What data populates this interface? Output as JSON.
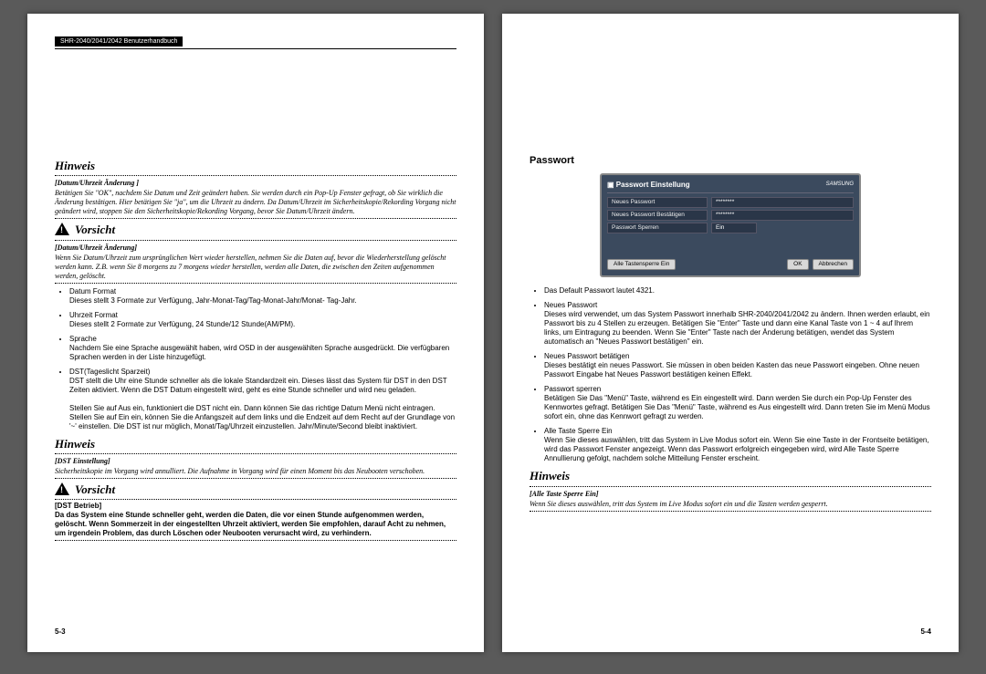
{
  "header": "SHR-2040/2041/2042 Benutzerhandbuch",
  "left": {
    "hinweis1_title": "Hinweis",
    "hinweis1_sub": "[Datum/Uhrzeit Änderung ]",
    "hinweis1_body": "Betätigen Sie \"OK\", nachdem Sie Datum und Zeit geändert haben. Sie werden durch ein Pop-Up Fenster gefragt, ob Sie wirklich die Änderung bestätigen. Hier betätigen Sie \"ja\", um die Uhrzeit zu ändern. Da Datum/Uhrzeit im Sicherheitskopie/Rekording Vorgang nicht geändert wird, stoppen Sie den Sicherheitskopie/Rekording Vorgang, bevor Sie Datum/Uhrzeit ändern.",
    "vorsicht1_title": "Vorsicht",
    "vorsicht1_sub": "[Datum/Uhrzeit Änderung]",
    "vorsicht1_body": "Wenn Sie Datum/Uhrzeit zum ursprünglichen Wert wieder herstellen, nehmen Sie die Daten auf, bevor die Wiederherstellung gelöscht werden kann. Z.B. wenn Sie 8 morgens zu 7 morgens wieder herstellen, werden alle Daten, die zwischen den Zeiten aufgenommen werden, gelöscht.",
    "b1_label": "Datum Format",
    "b1_text": "Dieses stellt 3 Formate zur Verfügung, Jahr-Monat-Tag/Tag-Monat-Jahr/Monat- Tag-Jahr.",
    "b2_label": "Uhrzeit Format",
    "b2_text": "Dieses stellt 2 Formate zur Verfügung, 24 Stunde/12 Stunde(AM/PM).",
    "b3_label": "Sprache",
    "b3_text": "Nachdem Sie eine Sprache ausgewählt haben, wird OSD in der ausgewählten Sprache ausgedrückt. Die verfügbaren Sprachen werden in der Liste hinzugefügt.",
    "b4_label": "DST(Tageslicht Sparzeit)",
    "b4_text": "DST stellt die Uhr eine Stunde schneller als die lokale Standardzeit ein. Dieses lässt das System für DST in den DST Zeiten aktiviert. Wenn die DST Datum eingestellt wird, geht es eine Stunde schneller und wird neu geladen.",
    "b4_text2": "Stellen Sie auf Aus ein, funktioniert die DST nicht ein. Dann können Sie das richtige Datum Menü nicht eintragen. Stellen Sie auf Ein ein, können Sie die Anfangszeit auf dem links und die Endzeit auf dem Recht auf der Grundlage von '~' einstellen. Die DST ist nur möglich, Monat/Tag/Uhrzeit einzustellen. Jahr/Minute/Second bleibt inaktiviert.",
    "hinweis2_title": "Hinweis",
    "hinweis2_sub": "[DST Einstellung]",
    "hinweis2_body": "Sicherheitskopie im Vorgang wird annulliert. Die Aufnahme in Vorgang wird für einen Moment bis das Neubooten verschoben.",
    "vorsicht2_title": "Vorsicht",
    "vorsicht2_sub": "[DST Betrieb]",
    "vorsicht2_body": "Da das System eine Stunde schneller geht, werden die Daten, die vor einen Stunde aufgenommen werden, gelöscht. Wenn Sommerzeit in der eingestellten Uhrzeit aktiviert, werden Sie empfohlen, darauf Acht zu nehmen, um irgendein Problem, das durch Löschen oder Neubooten verursacht wird, zu verhindern.",
    "pagenum": "5-3"
  },
  "right": {
    "section_title": "Passwort",
    "ui": {
      "title": "Passwort Einstellung",
      "logo": "SAMSUNG",
      "row1_label": "Neues Passwort",
      "row1_value": "********",
      "row2_label": "Neues Passwort Bestätigen",
      "row2_value": "********",
      "row3_label": "Passwort Sperren",
      "row3_value": "Ein",
      "btn_left": "Alle Tastensperre Ein",
      "btn_ok": "OK",
      "btn_cancel": "Abbrechen"
    },
    "b1": "Das Default Passwort lautet 4321.",
    "b2_label": "Neues Passwort",
    "b2_text": "Dieses wird verwendet, um das System Passwort innerhalb SHR-2040/2041/2042 zu ändern. Ihnen werden erlaubt, ein Passwort bis zu 4 Stellen zu erzeugen. Betätigen Sie \"Enter\" Taste und dann eine Kanal Taste von 1 ~ 4 auf Ihrem links, um Eintragung zu beenden. Wenn Sie \"Enter\" Taste nach der Änderung betätigen, wendet das System automatisch an \"Neues Passwort bestätigen\" ein.",
    "b3_label": "Neues Passwort betätigen",
    "b3_text": "Dieses bestätigt ein neues Passwort. Sie müssen in oben beiden Kasten das neue Passwort eingeben. Ohne neuen Passwort Eingabe hat Neues Passwort bestätigen keinen Effekt.",
    "b4_label": "Passwort sperren",
    "b4_text": "Betätigen Sie Das \"Menü\" Taste, während es Ein eingestellt wird. Dann werden Sie durch ein Pop-Up Fenster des Kennwortes gefragt. Betätigen Sie Das \"Menü\" Taste, während es Aus eingestellt wird. Dann treten Sie im Menü Modus sofort ein, ohne das Kennwort gefragt zu werden.",
    "b5_label": "Alle Taste Sperre Ein",
    "b5_text": "Wenn Sie dieses auswählen, tritt das System in Live Modus sofort ein. Wenn Sie eine Taste in der Frontseite betätigen, wird das Passwort Fenster angezeigt. Wenn das Passwort erfolgreich eingegeben wird, wird Alle Taste Sperre Annullierung gefolgt, nachdem solche Mitteilung Fenster erscheint.",
    "hinweis_title": "Hinweis",
    "hinweis_sub": "[Alle Taste Sperre Ein]",
    "hinweis_body": "Wenn Sie dieses auswählen, tritt das System im Live Modus sofort ein und die Tasten werden gesperrt.",
    "pagenum": "5-4"
  }
}
